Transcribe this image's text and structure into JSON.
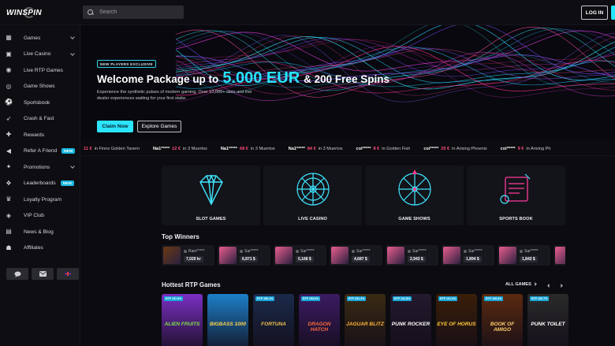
{
  "header": {
    "logo_text": "WINSPIN",
    "search_placeholder": "Search",
    "login_label": "LOG IN"
  },
  "sidebar": {
    "items": [
      {
        "label": "Games",
        "icon": "games-icon",
        "chevron": true
      },
      {
        "label": "Live Casino",
        "icon": "live-casino-icon",
        "chevron": true
      },
      {
        "label": "Live RTP Games",
        "icon": "rtp-icon"
      },
      {
        "label": "Game Shows",
        "icon": "game-shows-icon"
      },
      {
        "label": "Sportsbook",
        "icon": "soccer-ball-icon"
      },
      {
        "label": "Crash & Fast",
        "icon": "rocket-icon"
      },
      {
        "label": "Rewards",
        "icon": "gift-icon"
      },
      {
        "label": "Refer A Friend",
        "icon": "megaphone-icon",
        "badge": "NEW"
      },
      {
        "label": "Promotions",
        "icon": "promotions-icon",
        "chevron": true
      },
      {
        "label": "Leaderboards",
        "icon": "leaderboard-icon",
        "badge": "NEW"
      },
      {
        "label": "Loyalty Program",
        "icon": "crown-icon"
      },
      {
        "label": "VIP Club",
        "icon": "vip-icon"
      },
      {
        "label": "News & Blog",
        "icon": "news-icon"
      },
      {
        "label": "Affiliates",
        "icon": "affiliates-icon"
      }
    ],
    "bottom_buttons": [
      "chat-icon",
      "mail-icon",
      "uk-flag-icon"
    ]
  },
  "hero": {
    "tag": "NEW PLAYERS EXCLUSIVE",
    "title_pre": "Welcome Package up to",
    "title_amount": "5.000 EUR",
    "title_post": "& 200 Free Spins",
    "description": "Experience the synthetic pulses of modern gaming. Over 10,000+ slots and live dealer experiences waiting for your first stake.",
    "claim_label": "Claim Now",
    "explore_label": "Explore Games"
  },
  "ticker": [
    {
      "user": "",
      "amount": "11 €",
      "text": "in Finns Golden Tavern"
    },
    {
      "user": "Na1*****",
      "amount": "12 €",
      "text": "in 3 Muertos"
    },
    {
      "user": "Na1*****",
      "amount": "68 €",
      "text": "in 3 Muertos"
    },
    {
      "user": "Na1*****",
      "amount": "84 €",
      "text": "in 3 Muertos"
    },
    {
      "user": "coi*****",
      "amount": "8 €",
      "text": "in Golden Fish"
    },
    {
      "user": "coi*****",
      "amount": "25 €",
      "text": "in Arising Phoenix"
    },
    {
      "user": "coi*****",
      "amount": "9 €",
      "text": "in Arising Ph"
    }
  ],
  "categories": [
    {
      "label": "SLOT GAMES",
      "icon": "diamond-icon"
    },
    {
      "label": "LIVE CASINO",
      "icon": "roulette-icon"
    },
    {
      "label": "GAME SHOWS",
      "icon": "wheel-icon"
    },
    {
      "label": "SPORTS BOOK",
      "icon": "slip-icon"
    }
  ],
  "top_winners": {
    "title": "Top Winners",
    "items": [
      {
        "user": "Ram*****",
        "amount": "7,020 kr",
        "thumb": "#6b3a12"
      },
      {
        "user": "Sar*****",
        "amount": "6,871 $",
        "thumb": "#e95d8d"
      },
      {
        "user": "Sar*****",
        "amount": "5,168 $",
        "thumb": "#e95d8d"
      },
      {
        "user": "Sar*****",
        "amount": "4,687 $",
        "thumb": "#e95d8d"
      },
      {
        "user": "Sar*****",
        "amount": "2,943 $",
        "thumb": "#e95d8d"
      },
      {
        "user": "Sar*****",
        "amount": "1,894 $",
        "thumb": "#e95d8d"
      },
      {
        "user": "Sar*****",
        "amount": "1,842 $",
        "thumb": "#e95d8d"
      },
      {
        "user": "",
        "amount": "",
        "thumb": "#e95d8d"
      }
    ]
  },
  "hottest": {
    "title": "Hottest RTP Games",
    "all_games_label": "ALL GAMES",
    "games": [
      {
        "rtp": "RTP 157.8%",
        "title": "ALIEN FRUITS",
        "bg": "#7a2fc2",
        "accent": "#7ee04a"
      },
      {
        "rtp": "",
        "title": "BIGBASS 1000",
        "bg": "#1d7fc9",
        "accent": "#ffd54a"
      },
      {
        "rtp": "RTP 156.1%",
        "title": "FORTUNA",
        "bg": "#1b2a4a",
        "accent": "#f1c04a"
      },
      {
        "rtp": "RTP 153.6%",
        "title": "DRAGON HATCH",
        "bg": "#3b1b62",
        "accent": "#ff6b3a"
      },
      {
        "rtp": "RTP 251.2%",
        "title": "JAGUAR BLITZ",
        "bg": "#3a2a12",
        "accent": "#ffb63a"
      },
      {
        "rtp": "RTP 141.8%",
        "title": "PUNK ROCKER",
        "bg": "#231a2e",
        "accent": "#ffffff"
      },
      {
        "rtp": "RTP 101.2%",
        "title": "EYE OF HORUS",
        "bg": "#3a1e08",
        "accent": "#ffcb3a"
      },
      {
        "rtp": "RTP 196.8%",
        "title": "BOOK OF AMIGO",
        "bg": "#5a2a10",
        "accent": "#ffd06a"
      },
      {
        "rtp": "RTP 160.7%",
        "title": "PUNK TOILET",
        "bg": "#2a2a2a",
        "accent": "#ffffff"
      }
    ]
  },
  "colors": {
    "accent": "#2de4ff",
    "badge": "#18b8e0",
    "ticker_amount": "#ff4d7a"
  }
}
